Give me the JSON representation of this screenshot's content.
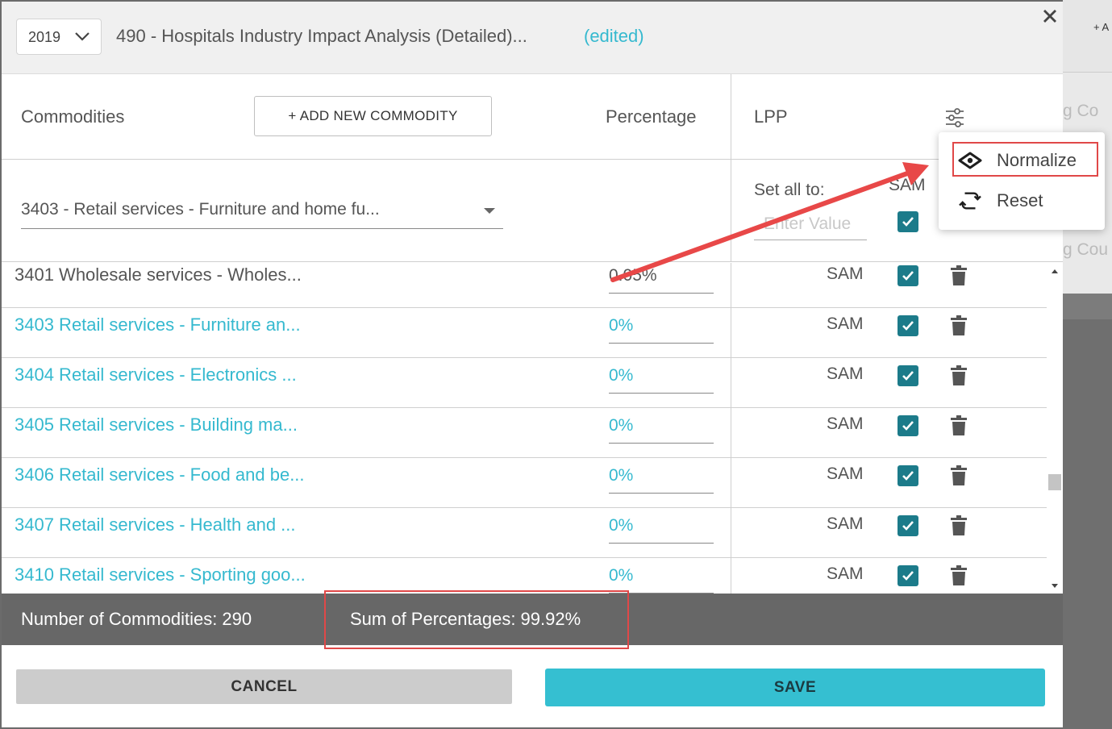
{
  "background": {
    "plus_label": "+ A",
    "text1": "g Co",
    "text2": "g Cou"
  },
  "header": {
    "year": "2019",
    "title": "490 - Hospitals Industry Impact Analysis (Detailed)...",
    "edited": "(edited)"
  },
  "columns": {
    "commodities": "Commodities",
    "add_commodity": "+ ADD NEW COMMODITY",
    "percentage": "Percentage",
    "lpp": "LPP"
  },
  "filter": {
    "selected_commodity": "3403 - Retail services - Furniture and home fu...",
    "set_all_label": "Set all to:",
    "set_all_placeholder": "Enter Value",
    "sam_header": "SAM"
  },
  "rows": [
    {
      "name": "3401 Wholesale services - Wholes...",
      "pct": "0.05%",
      "lpp": "SAM"
    },
    {
      "name": "3403 Retail services - Furniture an...",
      "pct": "0%",
      "lpp": "SAM"
    },
    {
      "name": "3404 Retail services - Electronics ...",
      "pct": "0%",
      "lpp": "SAM"
    },
    {
      "name": "3405 Retail services - Building ma...",
      "pct": "0%",
      "lpp": "SAM"
    },
    {
      "name": "3406 Retail services - Food and be...",
      "pct": "0%",
      "lpp": "SAM"
    },
    {
      "name": "3407 Retail services - Health and ...",
      "pct": "0%",
      "lpp": "SAM"
    },
    {
      "name": "3410 Retail services - Sporting goo...",
      "pct": "0%",
      "lpp": "SAM"
    }
  ],
  "summary": {
    "count_label": "Number of Commodities: 290",
    "sum_label": "Sum of Percentages: 99.92%"
  },
  "footer": {
    "cancel": "CANCEL",
    "save": "SAVE"
  },
  "menu": {
    "normalize": "Normalize",
    "reset": "Reset"
  },
  "colors": {
    "accent": "#35bfd1",
    "link": "#35b9cf",
    "checkbox": "#1c7b8a",
    "summary_bar": "#676767",
    "annotation": "#e04848"
  },
  "icons": [
    "chevron-down-icon",
    "close-icon",
    "filter-sliders-icon",
    "checkbox-checked-icon",
    "trash-icon",
    "eye-icon",
    "reset-icon"
  ]
}
